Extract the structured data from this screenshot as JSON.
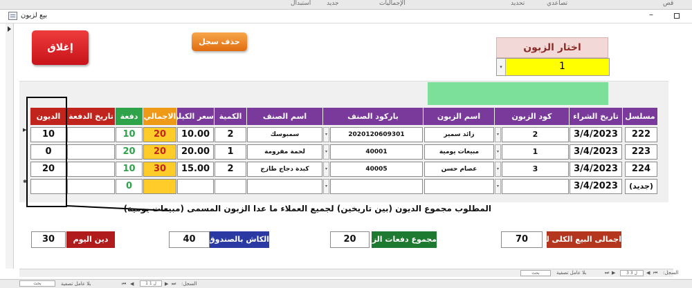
{
  "ribbon": {
    "items": [
      "قص",
      "تصاعدي",
      "تحديد",
      "الإجماليات",
      "جديد",
      "استبدال"
    ]
  },
  "window": {
    "title": "بيع لزبون",
    "minimize": "–"
  },
  "form": {
    "close_label": "إغلاق",
    "delete_label": "حذف سجل",
    "choose_customer_label": "اختار الزبون",
    "customer_value": "1",
    "dropdown_glyph": "▾"
  },
  "columns": {
    "serial": "مسلسل",
    "purchase_date": "تاريخ الشراء",
    "customer_code": "كود الزبون",
    "customer_name": "اسم الزبون",
    "item_barcode": "باركود الصنف",
    "item_name": "اسم الصنف",
    "quantity": "الكمية",
    "kilo_price": "سعر الكيلو",
    "total": "الاجمالي",
    "payment": "دفعة",
    "payment_date": "تاريخ الدفعة",
    "debt": "الديون"
  },
  "rows": [
    {
      "serial": "222",
      "purchase_date": "3/4/2023",
      "customer_code": "2",
      "customer_name": "زائد سمير",
      "item_barcode": "2020120609301",
      "item_name": "سمبوسك",
      "quantity": "2",
      "kilo_price": "10.00",
      "total": "20",
      "payment": "10",
      "payment_date": "",
      "debt": "10"
    },
    {
      "serial": "223",
      "purchase_date": "3/4/2023",
      "customer_code": "1",
      "customer_name": "مبيعات يومية",
      "item_barcode": "40001",
      "item_name": "لحمة مفرومة",
      "quantity": "1",
      "kilo_price": "20.00",
      "total": "20",
      "payment": "20",
      "payment_date": "",
      "debt": "0"
    },
    {
      "serial": "224",
      "purchase_date": "3/4/2023",
      "customer_code": "3",
      "customer_name": "عصام حسن",
      "item_barcode": "40005",
      "item_name": "كبدة دجاج طازج",
      "quantity": "2",
      "kilo_price": "15.00",
      "total": "30",
      "payment": "10",
      "payment_date": "",
      "debt": "20"
    }
  ],
  "new_row": {
    "serial": "(جديد)",
    "purchase_date": "3/4/2023",
    "payment": "0"
  },
  "note": "المطلوب مجموع الديون (بين تاريخين) لجميع العملاء ما عدا الزبون المسمى (مبيعات يومية)",
  "totals": {
    "sales_label": "اجمالى البيع الكلى لليوم",
    "sales_value": "70",
    "payments_label": "مجموع دفعات الزبائن",
    "payments_value": "20",
    "cash_label": "الكاش بالصندوق",
    "cash_value": "40",
    "debt_label": "دين اليوم",
    "debt_value": "30"
  },
  "statusbar": {
    "record_label": "السجل:",
    "record_position": "3 ل 3",
    "no_filter": "بلا عامل تصفية",
    "search": "بحث"
  },
  "bottombar": {
    "record_label": "السجل:",
    "record_position": "1 ل 1",
    "no_filter": "بلا عامل تصفية",
    "search": "بحث"
  },
  "colors": {
    "header_purple": "#7a3a9b",
    "header_red": "#c1241c",
    "header_green": "#2ea34a",
    "header_orange": "#ef9a16",
    "customer_combo": "#ffff00",
    "close_button": "#d8222a",
    "delete_button": "#ee8525"
  }
}
